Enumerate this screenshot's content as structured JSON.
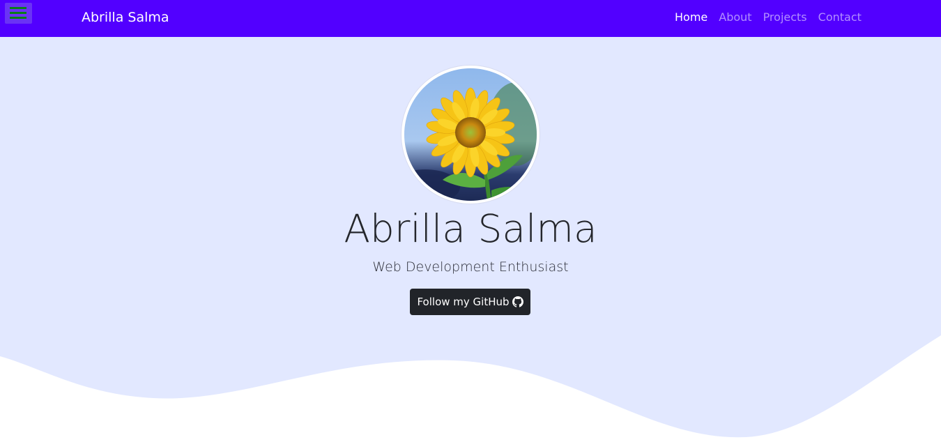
{
  "navbar": {
    "brand": "Abrilla Salma",
    "toggle_icon": "hamburger-menu-icon",
    "links": [
      {
        "label": "Home",
        "active": true
      },
      {
        "label": "About",
        "active": false
      },
      {
        "label": "Projects",
        "active": false
      },
      {
        "label": "Contact",
        "active": false
      }
    ]
  },
  "hero": {
    "name": "Abrilla Salma",
    "tagline": "Web Development Enthusiast",
    "button_label": "Follow my GitHub",
    "button_icon": "github-icon",
    "avatar_subject": "sunflower"
  },
  "colors": {
    "navbar_bg": "#5200ff",
    "hero_bg": "#e2e8ff",
    "button_bg": "#212429",
    "toggle_bg": "#6a33f5",
    "toggle_lines": "#0b7d1a"
  }
}
